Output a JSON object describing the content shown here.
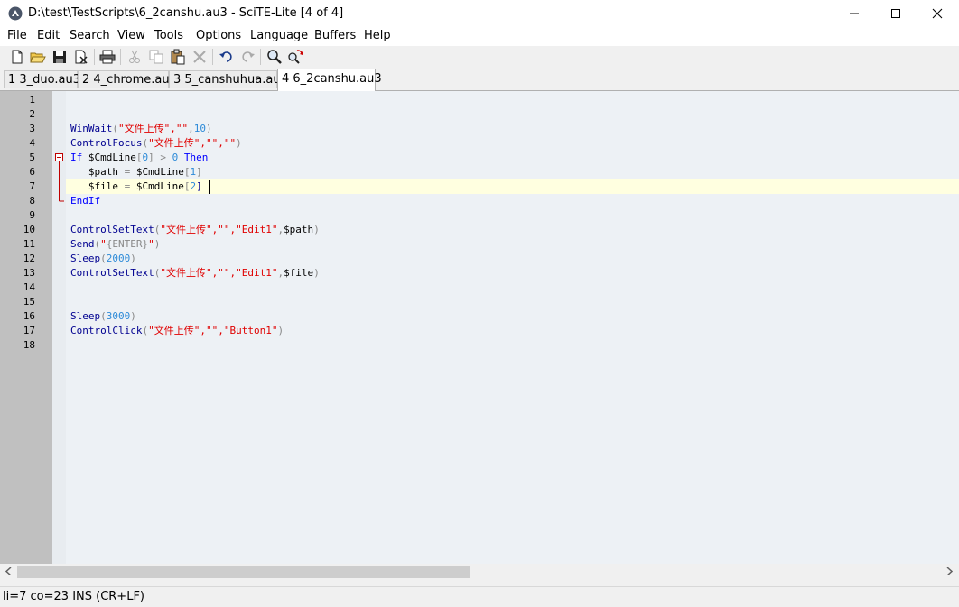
{
  "window": {
    "title": "D:\\test\\TestScripts\\6_2canshu.au3 - SciTE-Lite [4 of 4]",
    "icon": "scite-icon"
  },
  "menu": [
    "File",
    "Edit",
    "Search",
    "View",
    "Tools",
    "Options",
    "Language",
    "Buffers",
    "Help"
  ],
  "toolbar": {
    "buttons": [
      "new-file-icon",
      "open-folder-icon",
      "save-icon",
      "close-file-icon",
      "print-icon",
      "cut-icon",
      "copy-icon",
      "paste-icon",
      "delete-icon",
      "undo-icon",
      "redo-icon",
      "find-icon",
      "replace-icon"
    ]
  },
  "tabs": [
    {
      "label": "1 3_duo.au3",
      "active": false
    },
    {
      "label": "2 4_chrome.au3",
      "active": false
    },
    {
      "label": "3 5_canshuhua.au3",
      "active": false
    },
    {
      "label": "4 6_2canshu.au3",
      "active": true
    }
  ],
  "editor": {
    "line_numbers": [
      "1",
      "2",
      "3",
      "4",
      "5",
      "6",
      "7",
      "8",
      "9",
      "10",
      "11",
      "12",
      "13",
      "14",
      "15",
      "16",
      "17",
      "18"
    ],
    "current_line": 7,
    "lines": [
      [],
      [],
      [
        {
          "t": "WinWait",
          "c": "fn"
        },
        {
          "t": "(",
          "c": "op"
        },
        {
          "t": "\"文件上传\",\"\"",
          "c": "str"
        },
        {
          "t": ",",
          "c": "op"
        },
        {
          "t": "10",
          "c": "num"
        },
        {
          "t": ")",
          "c": "op"
        }
      ],
      [
        {
          "t": "ControlFocus",
          "c": "fn"
        },
        {
          "t": "(",
          "c": "op"
        },
        {
          "t": "\"文件上传\",\"\",\"\"",
          "c": "str"
        },
        {
          "t": ")",
          "c": "op"
        }
      ],
      [
        {
          "t": "If",
          "c": "kw"
        },
        {
          "t": " $CmdLine",
          "c": "var"
        },
        {
          "t": "[",
          "c": "op"
        },
        {
          "t": "0",
          "c": "num"
        },
        {
          "t": "] > ",
          "c": "op"
        },
        {
          "t": "0",
          "c": "num"
        },
        {
          "t": " ",
          "c": "var"
        },
        {
          "t": "Then",
          "c": "kw"
        }
      ],
      [
        {
          "t": "   $path ",
          "c": "var"
        },
        {
          "t": "=",
          "c": "op"
        },
        {
          "t": " $CmdLine",
          "c": "var"
        },
        {
          "t": "[",
          "c": "op"
        },
        {
          "t": "1",
          "c": "num"
        },
        {
          "t": "]",
          "c": "op"
        }
      ],
      [
        {
          "t": "   $file ",
          "c": "var"
        },
        {
          "t": "=",
          "c": "op"
        },
        {
          "t": " $CmdLine",
          "c": "var"
        },
        {
          "t": "[",
          "c": "op"
        },
        {
          "t": "2",
          "c": "num"
        },
        {
          "t": "]",
          "c": "fn"
        }
      ],
      [
        {
          "t": "EndIf",
          "c": "kw"
        }
      ],
      [],
      [
        {
          "t": "ControlSetText",
          "c": "fn"
        },
        {
          "t": "(",
          "c": "op"
        },
        {
          "t": "\"文件上传\",\"\",\"Edit1\"",
          "c": "str"
        },
        {
          "t": ",",
          "c": "op"
        },
        {
          "t": "$path",
          "c": "var"
        },
        {
          "t": ")",
          "c": "op"
        }
      ],
      [
        {
          "t": "Send",
          "c": "fn"
        },
        {
          "t": "(",
          "c": "op"
        },
        {
          "t": "\"",
          "c": "str"
        },
        {
          "t": "{ENTER}",
          "c": "op"
        },
        {
          "t": "\"",
          "c": "str"
        },
        {
          "t": ")",
          "c": "op"
        }
      ],
      [
        {
          "t": "Sleep",
          "c": "fn"
        },
        {
          "t": "(",
          "c": "op"
        },
        {
          "t": "2000",
          "c": "num"
        },
        {
          "t": ")",
          "c": "op"
        }
      ],
      [
        {
          "t": "ControlSetText",
          "c": "fn"
        },
        {
          "t": "(",
          "c": "op"
        },
        {
          "t": "\"文件上传\",\"\",\"Edit1\"",
          "c": "str"
        },
        {
          "t": ",",
          "c": "op"
        },
        {
          "t": "$file",
          "c": "var"
        },
        {
          "t": ")",
          "c": "op"
        }
      ],
      [],
      [],
      [
        {
          "t": "Sleep",
          "c": "fn"
        },
        {
          "t": "(",
          "c": "op"
        },
        {
          "t": "3000",
          "c": "num"
        },
        {
          "t": ")",
          "c": "op"
        }
      ],
      [
        {
          "t": "ControlClick",
          "c": "fn"
        },
        {
          "t": "(",
          "c": "op"
        },
        {
          "t": "\"文件上传\",\"\",\"Button1\"",
          "c": "str"
        },
        {
          "t": ")",
          "c": "op"
        }
      ],
      []
    ]
  },
  "status": "li=7 co=23 INS (CR+LF)",
  "colors": {
    "gutter": "#c0c0c0",
    "editor_bg": "#edf1f5",
    "caret_line": "#ffffe0",
    "fold_marker": "#c00000"
  }
}
